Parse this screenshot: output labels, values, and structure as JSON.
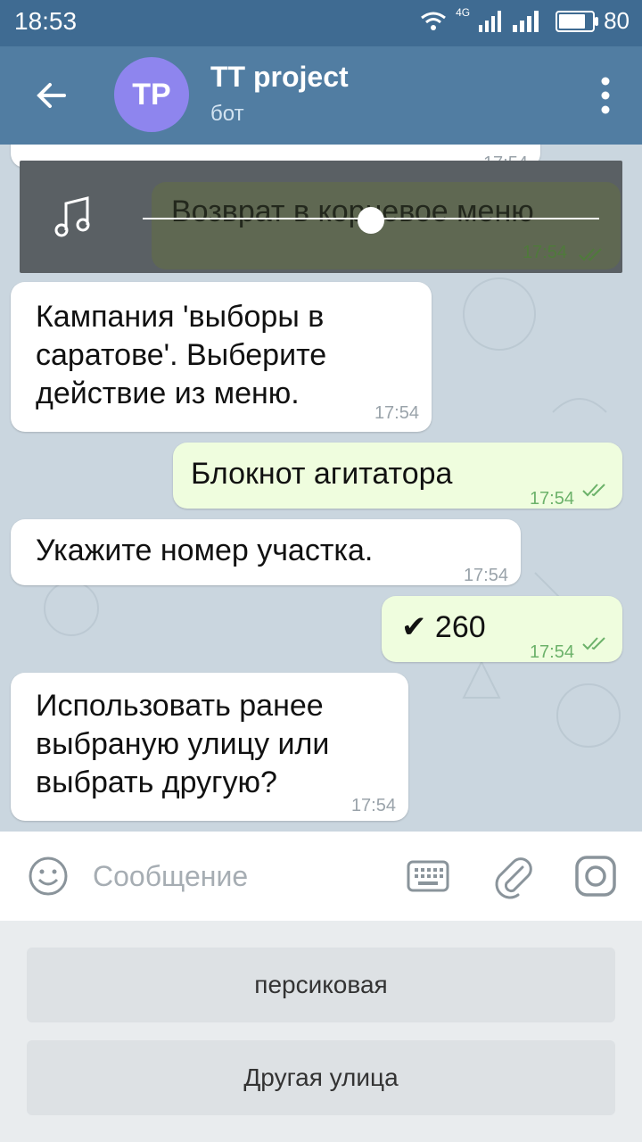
{
  "status": {
    "time": "18:53",
    "network": "4G",
    "battery": "80",
    "battery_level": 0.8
  },
  "header": {
    "avatar_initials": "TP",
    "title": "TT project",
    "subtitle": "бот"
  },
  "pinned": {
    "partial_time": "17:54",
    "text": "Возврат в корневое меню",
    "time": "17:54",
    "progress": 0.5
  },
  "messages": [
    {
      "dir": "in",
      "text": "Кампания 'выборы в саратове'. Выберите действие из меню.",
      "time": "17:54"
    },
    {
      "dir": "out",
      "text": "Блокнот агитатора",
      "time": "17:54"
    },
    {
      "dir": "in",
      "text": "Укажите номер участка.",
      "time": "17:54"
    },
    {
      "dir": "out",
      "text": "✔ 260",
      "time": "17:54"
    },
    {
      "dir": "in",
      "text": "Использовать ранее выбраную улицу или выбрать другую?",
      "time": "17:54"
    }
  ],
  "input": {
    "placeholder": "Сообщение"
  },
  "keyboard": {
    "buttons": [
      "персиковая",
      "Другая улица"
    ]
  },
  "icons": [
    "back-arrow-icon",
    "more-vert-icon",
    "music-note-icon",
    "double-check-icon",
    "emoji-icon",
    "keyboard-icon",
    "attach-icon",
    "camera-icon",
    "wifi-icon",
    "signal-icon",
    "battery-icon"
  ]
}
